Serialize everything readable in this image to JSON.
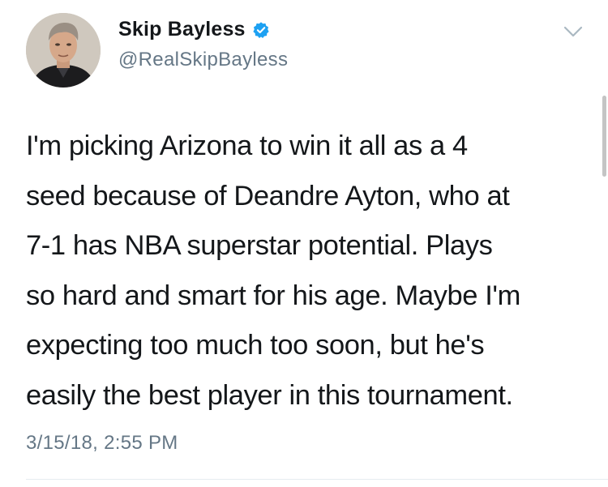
{
  "author": {
    "display_name": "Skip Bayless",
    "handle": "@RealSkipBayless",
    "verified": true,
    "avatar_icon": "profile-photo",
    "verified_icon": "verified-badge-icon"
  },
  "tweet": {
    "text_lines": [
      "I'm picking Arizona to win it all as a 4",
      "seed because of Deandre Ayton, who at",
      "7-1 has NBA superstar potential. Plays",
      "so hard and smart for his age. Maybe I'm",
      "expecting too much too soon, but he's",
      "easily the best player in this tournament."
    ],
    "timestamp": "3/15/18, 2:55 PM"
  },
  "menu": {
    "icon": "chevron-down-icon"
  },
  "colors": {
    "text": "#14171a",
    "secondary": "#657786",
    "verified_blue": "#1da1f2",
    "chevron": "#aab8c2",
    "divider": "#e6ecf0"
  }
}
